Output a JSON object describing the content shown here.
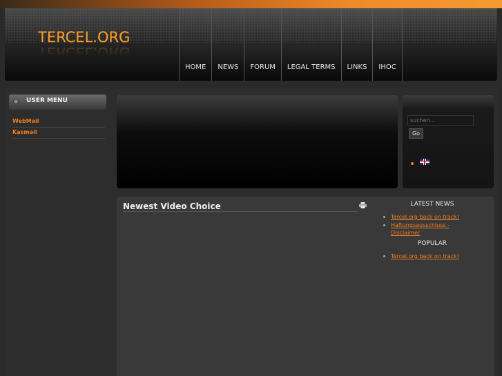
{
  "site": {
    "logo": "TERCEL.ORG"
  },
  "nav": {
    "items": [
      {
        "label": "HOME"
      },
      {
        "label": "NEWS"
      },
      {
        "label": "FORUM"
      },
      {
        "label": "LEGAL TERMS"
      },
      {
        "label": "LINKS"
      },
      {
        "label": "IHOC"
      }
    ]
  },
  "user_menu": {
    "title": "USER MENU",
    "links": [
      {
        "label": "WebMail"
      },
      {
        "label": "Kasmail"
      }
    ]
  },
  "search": {
    "placeholder": "suchen...",
    "button_label": "Go"
  },
  "language": {
    "icon": "uk-flag-icon"
  },
  "content": {
    "title": "Newest Video Choice"
  },
  "latest_news": {
    "title": "LATEST NEWS",
    "items": [
      {
        "label": "Tercel.org back on track!"
      },
      {
        "label": "Haftungsausschluss - Disclaimer"
      }
    ]
  },
  "popular": {
    "title": "POPULAR",
    "items": [
      {
        "label": "Tercel.org back on track!"
      }
    ]
  },
  "colors": {
    "accent": "#f07f1f",
    "background": "#2a2a2a"
  }
}
